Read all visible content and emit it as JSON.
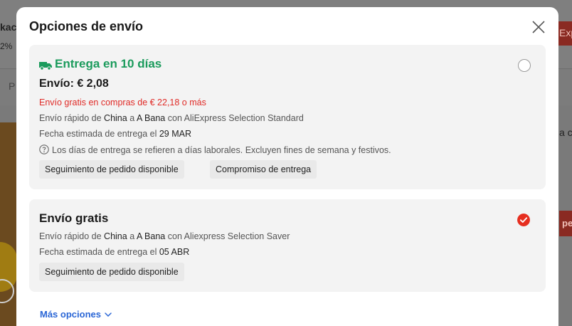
{
  "background": {
    "title_fragment": "kac",
    "percent_fragment": "2%",
    "tab_fragment": "P",
    "right_fragment": "a c",
    "brand_fragment": "Exp",
    "button_fragment": "pe"
  },
  "modal": {
    "title": "Opciones de envío",
    "close_icon": "close-icon",
    "options": [
      {
        "title": "Entrega en 10 días",
        "title_color": "#1b9b5c",
        "price": "Envío: € 2,08",
        "free_note": "Envío gratis en compras de € 22,18 o más",
        "shipping_prefix": "Envío rápido de ",
        "origin": "China",
        "to_text": " a ",
        "destination": "A Bana",
        "carrier_text": " con AliExpress Selection Standard",
        "eta_prefix": "Fecha estimada de entrega el ",
        "eta_date": "29 MAR",
        "info_note": "Los días de entrega se refieren a días laborales. Excluyen fines de semana y festivos.",
        "tags": [
          "Seguimiento de pedido disponible",
          "Compromiso de entrega"
        ],
        "selected": false
      },
      {
        "title": "Envío gratis",
        "shipping_prefix": "Envío rápido de ",
        "origin": "China",
        "to_text": " a ",
        "destination": "A Bana",
        "carrier_text": " con Aliexpress Selection Saver",
        "eta_prefix": "Fecha estimada de entrega el ",
        "eta_date": "05 ABR",
        "tags": [
          "Seguimiento de pedido disponible"
        ],
        "selected": true
      }
    ],
    "more_options": "Más opciones"
  },
  "colors": {
    "accent_red": "#e62e1f",
    "delivery_green": "#1b9b5c",
    "link_blue": "#2a66d6"
  }
}
